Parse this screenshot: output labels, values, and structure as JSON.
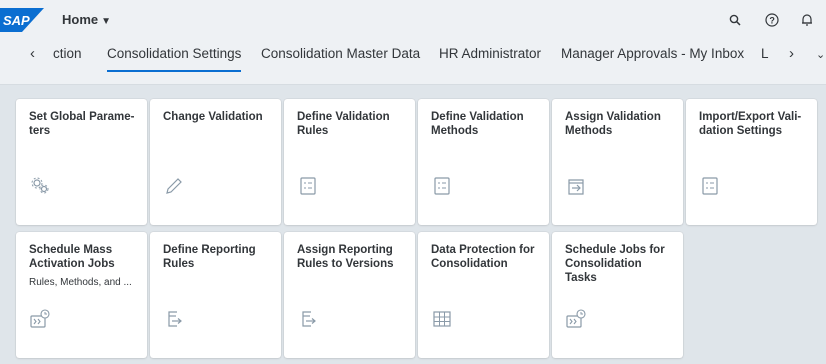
{
  "header": {
    "logo_text": "SAP",
    "home_label": "Home",
    "icons": [
      "search-icon",
      "help-icon",
      "notification-icon"
    ]
  },
  "tabs": [
    {
      "label": "ction",
      "active": false
    },
    {
      "label": "Consolidation Settings",
      "active": true
    },
    {
      "label": "Consolidation Master Data",
      "active": false
    },
    {
      "label": "HR Administrator",
      "active": false
    },
    {
      "label": "Manager Approvals - My Inbox",
      "active": false
    },
    {
      "label": "L",
      "active": false
    }
  ],
  "tiles": [
    {
      "title": "Set Global Parame-ters",
      "subtitle": "",
      "icon": "gears-icon"
    },
    {
      "title": "Change Validation",
      "subtitle": "",
      "icon": "pencil-icon"
    },
    {
      "title": "Define Validation Rules",
      "subtitle": "",
      "icon": "checklist-icon"
    },
    {
      "title": "Define Validation Methods",
      "subtitle": "",
      "icon": "checklist-icon"
    },
    {
      "title": "Assign Validation Methods",
      "subtitle": "",
      "icon": "assign-arrow-icon"
    },
    {
      "title": "Import/Export Vali-dation Settings",
      "subtitle": "",
      "icon": "checklist-icon"
    },
    {
      "title": "Schedule Mass Activation Jobs",
      "subtitle": "Rules, Methods, and ...",
      "icon": "schedule-jobs-icon"
    },
    {
      "title": "Define Reporting Rules",
      "subtitle": "",
      "icon": "reporting-rules-icon"
    },
    {
      "title": "Assign Reporting Rules to Versions",
      "subtitle": "",
      "icon": "reporting-rules-icon"
    },
    {
      "title": "Data Protection for Consolidation",
      "subtitle": "",
      "icon": "grid-table-icon"
    },
    {
      "title": "Schedule Jobs for Consolidation Tasks",
      "subtitle": "",
      "icon": "schedule-jobs-icon"
    }
  ]
}
